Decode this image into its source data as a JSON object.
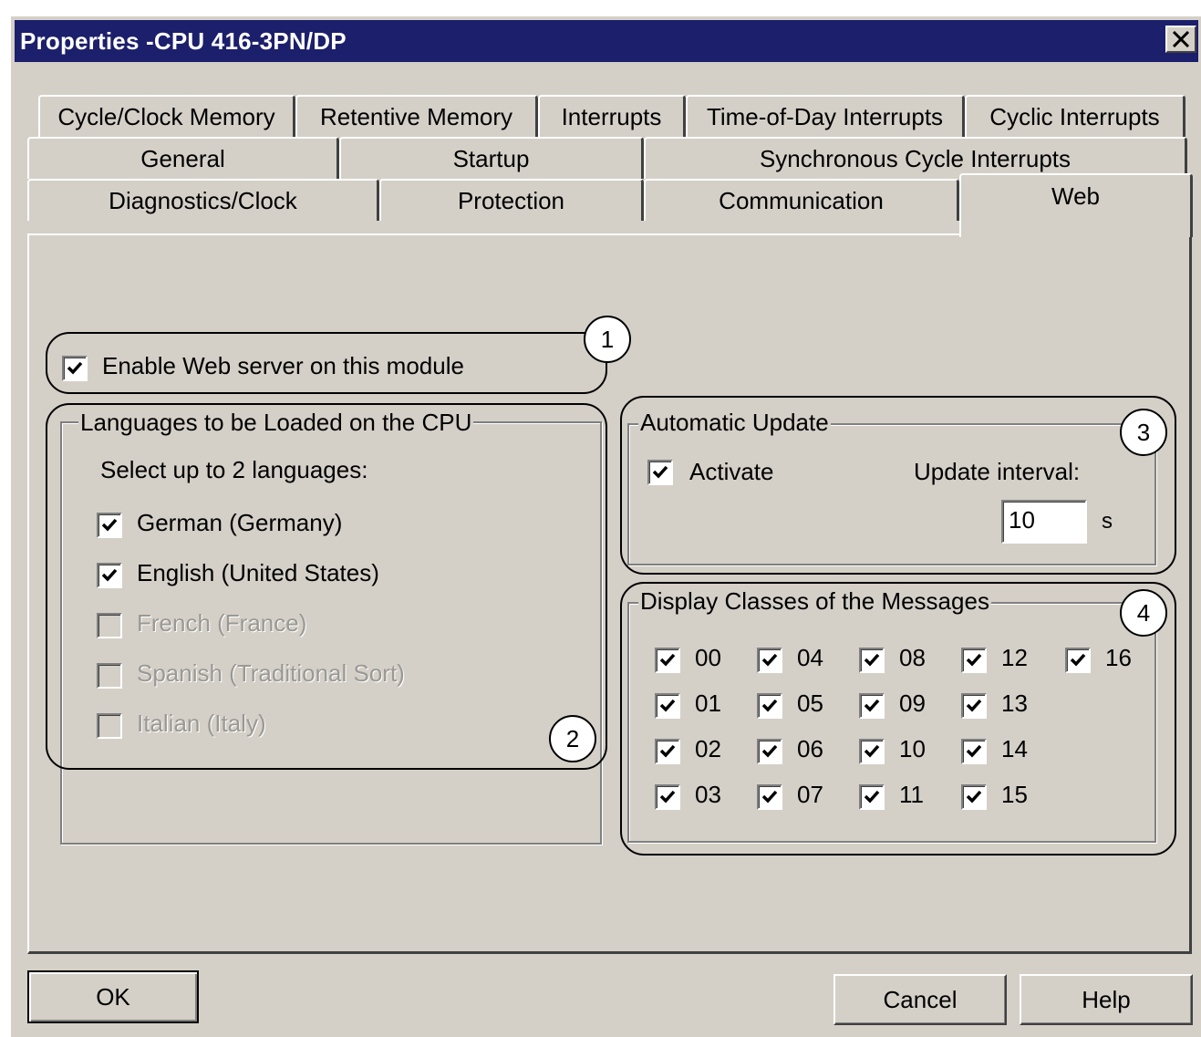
{
  "window": {
    "title": "Properties -CPU 416-3PN/DP",
    "close_symbol": "✕"
  },
  "tabs": {
    "row1": [
      "Cycle/Clock Memory",
      "Retentive Memory",
      "Interrupts",
      "Time-of-Day Interrupts",
      "Cyclic Interrupts"
    ],
    "row2": [
      "General",
      "Startup",
      "Synchronous Cycle Interrupts"
    ],
    "row3": [
      "Diagnostics/Clock",
      "Protection",
      "Communication",
      "Web"
    ],
    "active": "Web"
  },
  "web_server": {
    "label": "Enable Web server on this module",
    "checked": true
  },
  "languages": {
    "legend": "Languages to be Loaded on the CPU",
    "instruction": "Select up to 2 languages:",
    "items": [
      {
        "label": "German (Germany)",
        "checked": true,
        "enabled": true
      },
      {
        "label": "English (United States)",
        "checked": true,
        "enabled": true
      },
      {
        "label": "French (France)",
        "checked": false,
        "enabled": false
      },
      {
        "label": "Spanish (Traditional Sort)",
        "checked": false,
        "enabled": false
      },
      {
        "label": "Italian (Italy)",
        "checked": false,
        "enabled": false
      }
    ]
  },
  "auto_update": {
    "legend": "Automatic Update",
    "activate_label": "Activate",
    "activate_checked": true,
    "interval_label": "Update interval:",
    "interval_value": "10",
    "interval_unit": "s"
  },
  "display_classes": {
    "legend": "Display Classes of the Messages",
    "items": [
      "00",
      "01",
      "02",
      "03",
      "04",
      "05",
      "06",
      "07",
      "08",
      "09",
      "10",
      "11",
      "12",
      "13",
      "14",
      "15",
      "16"
    ]
  },
  "markers": [
    "1",
    "2",
    "3",
    "4"
  ],
  "buttons": {
    "ok": "OK",
    "cancel": "Cancel",
    "help": "Help"
  },
  "colors": {
    "titlebar": "#1c1f6b",
    "dialog_bg": "#d4d0c8",
    "disabled_text": "#9a9893"
  }
}
